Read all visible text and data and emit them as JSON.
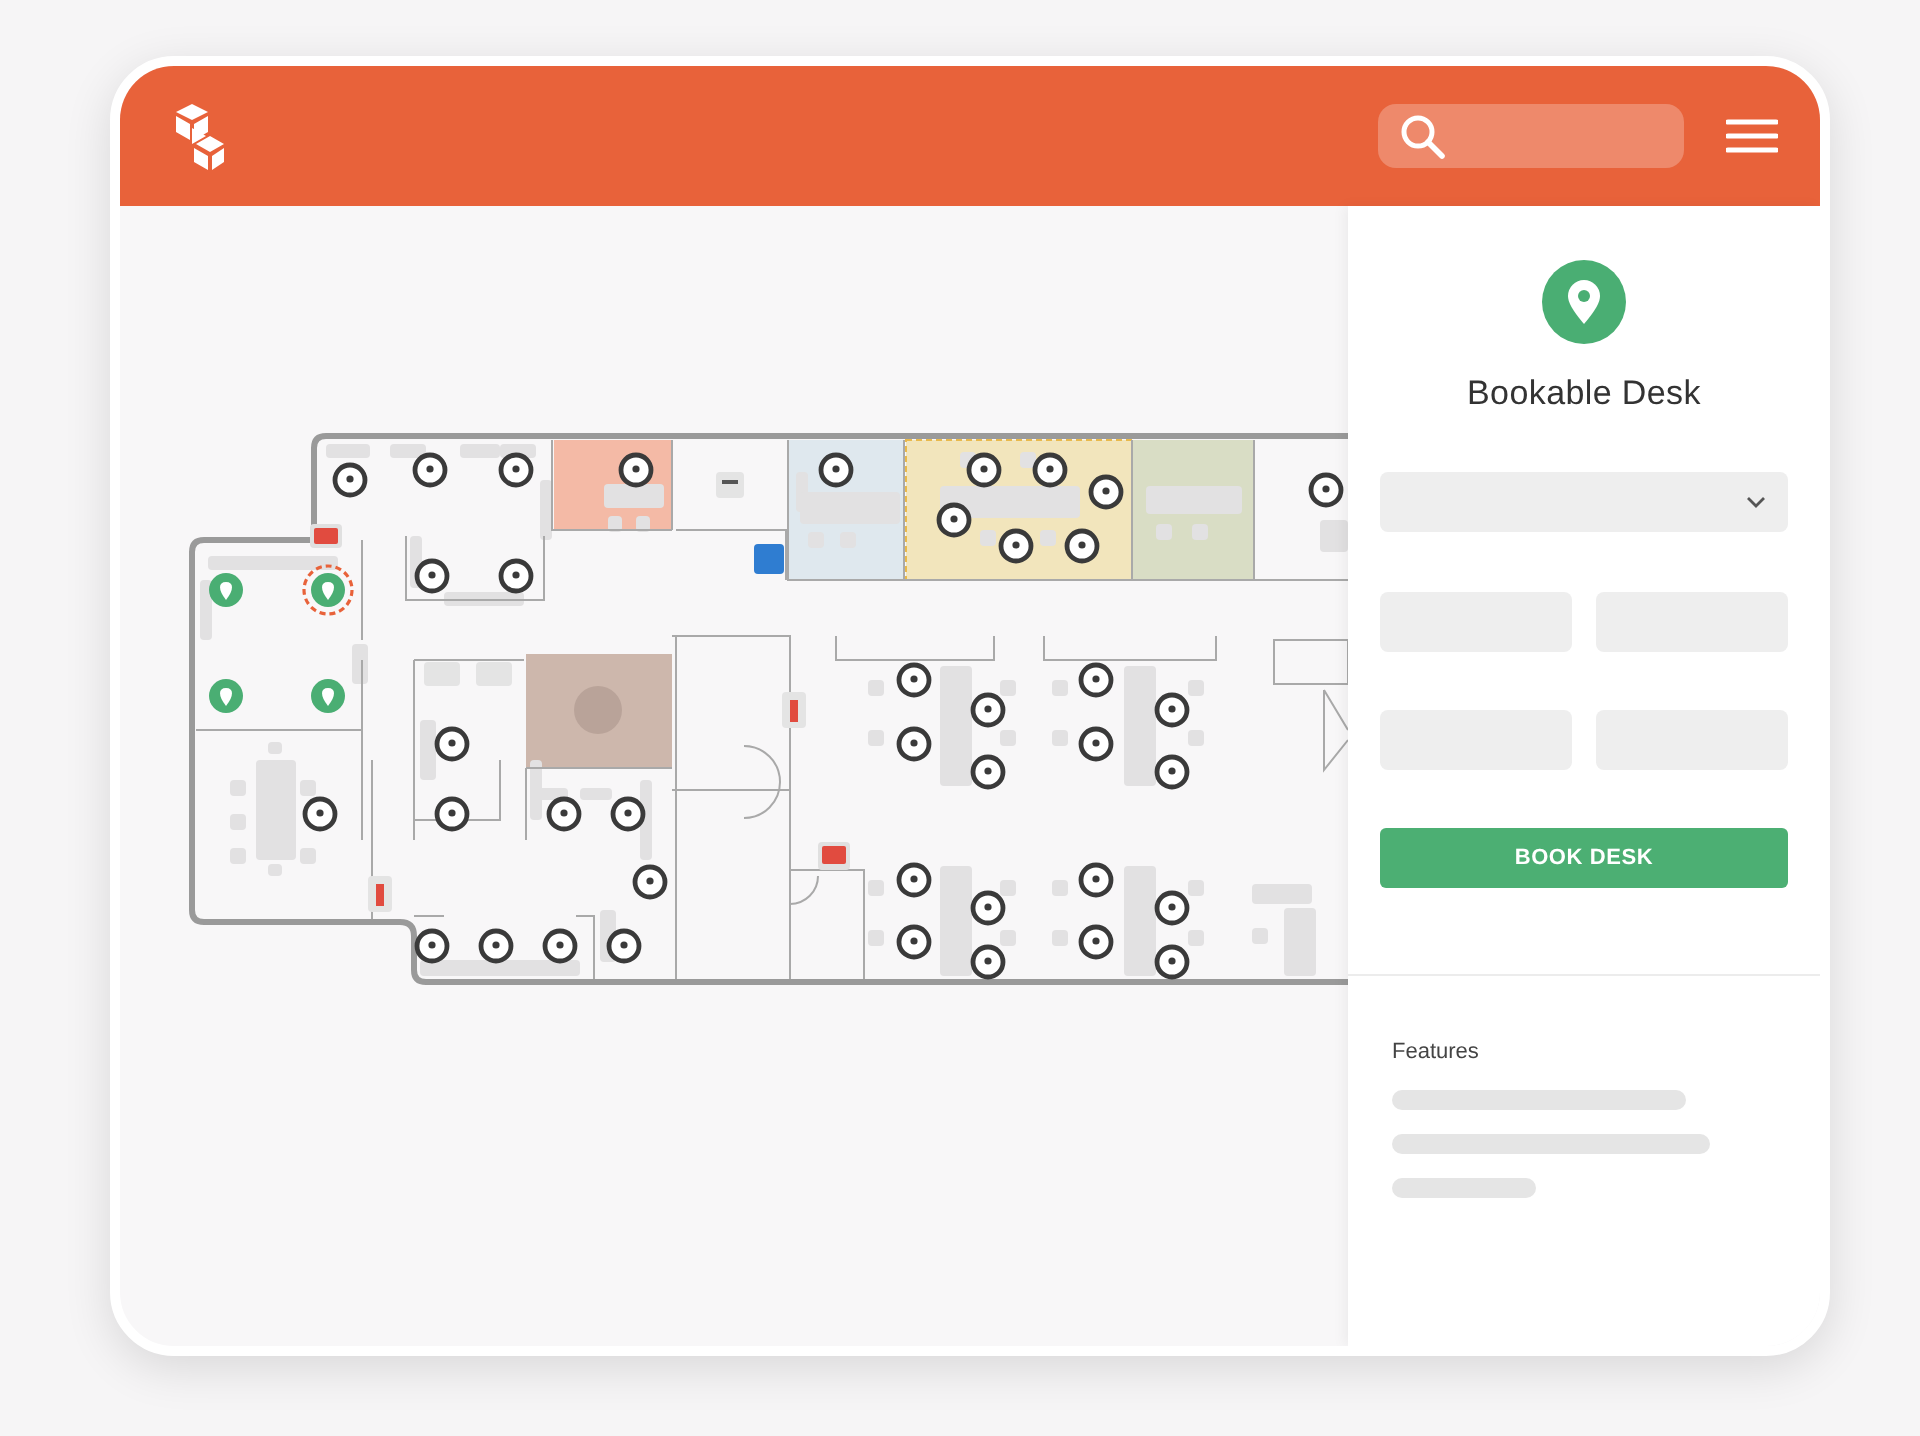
{
  "map": {
    "desks": [
      {
        "kind": "available",
        "selected": false
      },
      {
        "kind": "available",
        "selected": true
      },
      {
        "kind": "available",
        "selected": false
      },
      {
        "kind": "available",
        "selected": false
      }
    ]
  },
  "panel": {
    "title": "Bookable Desk",
    "button": "BOOK DESK",
    "features": {
      "heading": "Features"
    }
  }
}
